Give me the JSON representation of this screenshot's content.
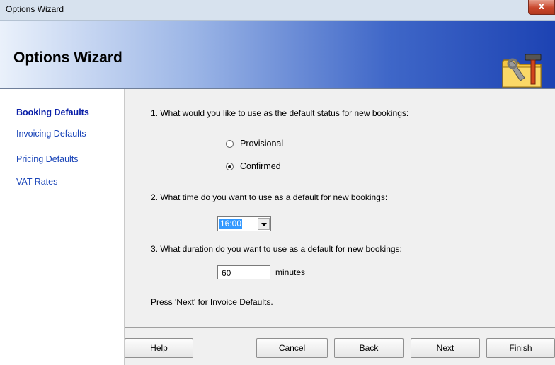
{
  "window": {
    "title": "Options Wizard",
    "close_label": "x"
  },
  "banner": {
    "title": "Options Wizard",
    "icon": "folder-tools-icon"
  },
  "sidebar": {
    "items": [
      {
        "label": "Booking Defaults",
        "active": true
      },
      {
        "label": "Invoicing Defaults",
        "active": false
      },
      {
        "label": "Pricing Defaults",
        "active": false
      },
      {
        "label": "VAT Rates",
        "active": false
      }
    ]
  },
  "main": {
    "q1": "1. What would you like to use as the default status for new bookings:",
    "status_options": [
      {
        "label": "Provisional",
        "checked": false
      },
      {
        "label": "Confirmed",
        "checked": true
      }
    ],
    "q2": "2. What time do you want to use as a default for new bookings:",
    "time_value": "16:00",
    "q3": "3. What duration do you want to use as a default for new bookings:",
    "duration_value": "60",
    "duration_unit": "minutes",
    "hint": "Press 'Next' for Invoice Defaults."
  },
  "buttons": {
    "help": "Help",
    "cancel": "Cancel",
    "back": "Back",
    "next": "Next",
    "finish": "Finish"
  },
  "colors": {
    "link": "#1a45b8",
    "banner_start": "#eaf1fb",
    "banner_end": "#1d43b3",
    "close": "#c9472c",
    "selection": "#3399ff"
  }
}
